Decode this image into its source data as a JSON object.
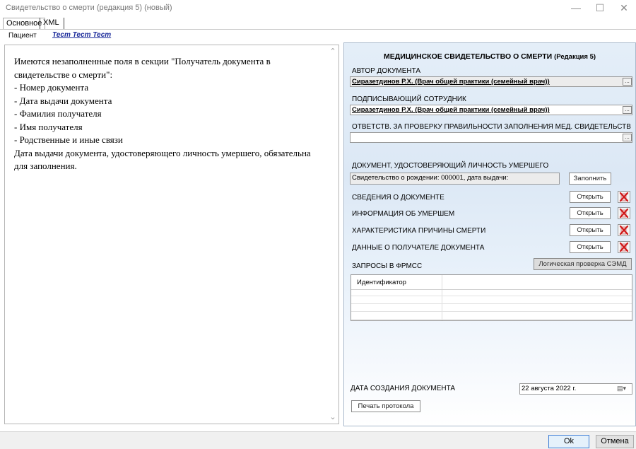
{
  "window": {
    "title": "Свидетельство о смерти (редакция 5) (новый)",
    "minimize_glyph": "—",
    "maximize_glyph": "☐",
    "close_glyph": "✕"
  },
  "tabs": [
    {
      "label": "Основное",
      "active": true
    },
    {
      "label": "XML",
      "active": false
    }
  ],
  "patient": {
    "label": "Пациент",
    "name": "Тест Тест Тест"
  },
  "validation": {
    "intro": "Имеются незаполненные поля в секции \"Получатель документа в свидетельстве о смерти\":",
    "items": [
      "- Номер документа",
      "- Дата выдачи документа",
      "- Фамилия получателя",
      "- Имя получателя",
      "- Родственные и иные связи"
    ],
    "extra": "Дата выдачи документа, удостоверяющего личность умершего, обязательна для заполнения."
  },
  "certificate": {
    "title": "МЕДИЦИНСКОЕ СВИДЕТЕЛЬСТВО О СМЕРТИ",
    "edition": "(Редакция 5)",
    "author_label": "АВТОР ДОКУМЕНТА",
    "author_value": "Сиразетдинов Р.Х. (Врач общей практики (семейный врач))",
    "signer_label": "ПОДПИСЫВАЮЩИЙ СОТРУДНИК",
    "signer_value": "Сиразетдинов Р.Х. (Врач общей практики (семейный врач))",
    "responsible_label": "ОТВЕТСТВ. ЗА ПРОВЕРКУ ПРАВИЛЬНОСТИ ЗАПОЛНЕНИЯ МЕД. СВИДЕТЕЛЬСТВ",
    "responsible_value": "",
    "dots_label": "...",
    "identity_label": "ДОКУМЕНТ, УДОСТОВЕРЯЮЩИЙ ЛИЧНОСТЬ УМЕРШЕГО",
    "identity_value": "Свидетельство о рождении: 000001, дата выдачи:",
    "fill_button": "Заполнить",
    "sections": [
      {
        "label": "СВЕДЕНИЯ О ДОКУМЕНТЕ",
        "button": "Открыть"
      },
      {
        "label": "ИНФОРМАЦИЯ ОБ УМЕРШЕМ",
        "button": "Открыть"
      },
      {
        "label": "ХАРАКТЕРИСТИКА ПРИЧИНЫ СМЕРТИ",
        "button": "Открыть"
      },
      {
        "label": "ДАННЫЕ О ПОЛУЧАТЕЛЕ ДОКУМЕНТА",
        "button": "Открыть"
      }
    ],
    "requests_label": "ЗАПРОСЫ В ФРМСС",
    "logic_check_button": "Логическая проверка СЭМД",
    "grid_header": "Идентификатор",
    "created_label": "ДАТА СОЗДАНИЯ ДОКУМЕНТА",
    "created_value": "22  августа  2022 г.",
    "print_button": "Печать протокола"
  },
  "footer": {
    "ok": "Ok",
    "cancel": "Отмена"
  },
  "colors": {
    "link": "#1a2a9a",
    "delete_icon": "#d01818",
    "ok_border": "#3f7fd6"
  }
}
